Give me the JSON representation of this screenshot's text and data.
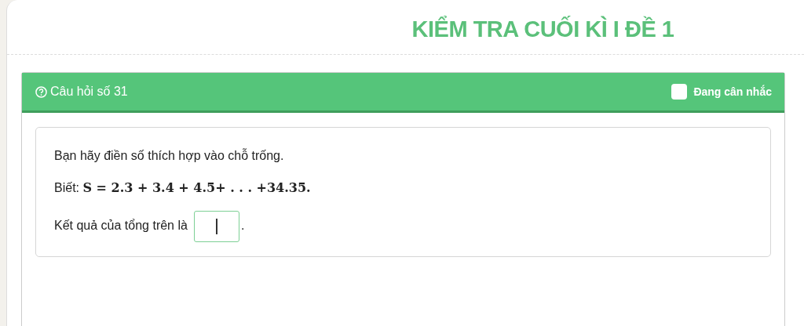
{
  "page_title": "KIỂM TRA CUỐI KÌ I ĐỀ 1",
  "question": {
    "label": "Câu hỏi số 31",
    "flag": {
      "label": "Đang cân nhắc",
      "checked": false
    }
  },
  "content": {
    "instruction": "Bạn hãy điền số thích hợp vào chỗ trống.",
    "given": {
      "prefix": "Biết:",
      "formula": "S = 2.3 + 3.4 + 4.5+ . . . +34.35."
    },
    "answer_line": {
      "text": "Kết quả của tổng trên là",
      "after": "."
    }
  }
}
